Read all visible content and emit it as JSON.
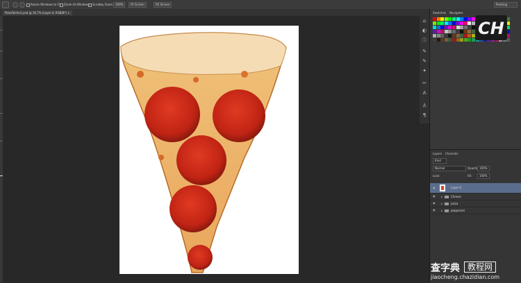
{
  "options_bar": {
    "resize_windows": "Resize Windows to Fit",
    "zoom_all": "Zoom All Windows",
    "scrubby_zoom": "Scrubby Zoom",
    "btn_100": "100%",
    "btn_fit": "Fit Screen",
    "btn_fill": "Fill Screen",
    "workspace": "Painting"
  },
  "document_tab": {
    "title": "PizzaTechnic.psd @ 16.7% (Layer 0, RGB/8*) ×"
  },
  "panels": {
    "top_tabs": [
      "Swatches",
      "Navigator"
    ],
    "layers_tabs": [
      "Layers",
      "Channels"
    ],
    "kind_filter": "Kind",
    "blend_mode": "Normal",
    "opacity_label": "Opacity:",
    "opacity_value": "100%",
    "lock_label": "Lock:",
    "fill_label": "Fill:",
    "fill_value": "100%",
    "layers": [
      {
        "name": "Layer 0",
        "type": "layer",
        "selected": true
      },
      {
        "name": "Cheese",
        "type": "group"
      },
      {
        "name": "pizza",
        "type": "group"
      },
      {
        "name": "pepperoni",
        "type": "group"
      }
    ]
  },
  "logo_text": "CH",
  "watermark": {
    "brand": "查字典",
    "tag": "教程网",
    "url": "jiaocheng.chazidian.com"
  },
  "colors": {
    "accent_selected": "#5b6d8c",
    "canvas_bg": "#282828",
    "panel_bg": "#383838"
  }
}
